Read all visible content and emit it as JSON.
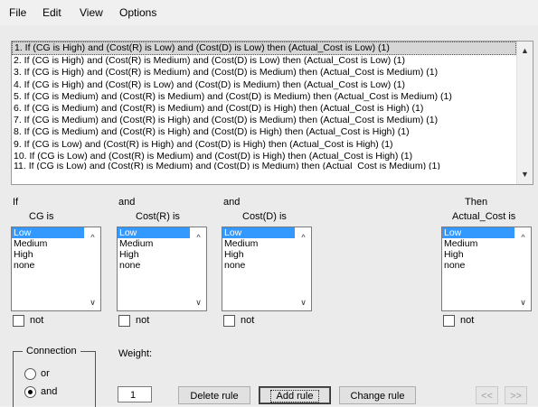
{
  "menu": [
    "File",
    "Edit",
    "View",
    "Options"
  ],
  "rules": [
    "1. If (CG is High) and (Cost(R) is Low) and (Cost(D) is Low) then (Actual_Cost is Low) (1)",
    "2. If (CG is High) and (Cost(R) is Medium) and (Cost(D) is Low) then (Actual_Cost is Low) (1)",
    "3. If (CG is High) and (Cost(R) is Medium) and (Cost(D) is Medium) then (Actual_Cost is Medium) (1)",
    "4. If (CG is High) and (Cost(R) is Low) and (Cost(D) is Medium) then (Actual_Cost is Low) (1)",
    "5. If (CG is Medium) and (Cost(R) is Medium) and (Cost(D) is Medium) then (Actual_Cost is Medium) (1)",
    "6. If (CG is Medium) and (Cost(R) is Medium) and (Cost(D) is High) then (Actual_Cost is High) (1)",
    "7. If (CG is Medium) and (Cost(R) is High) and (Cost(D) is Medium) then (Actual_Cost is Medium) (1)",
    "8. If (CG is Medium) and (Cost(R) is High) and (Cost(D) is High) then (Actual_Cost is High) (1)",
    "9. If (CG is Low) and (Cost(R) is High) and (Cost(D) is High) then (Actual_Cost is High) (1)",
    "10. If (CG is Low) and (Cost(R) is Medium) and (Cost(D) is High) then (Actual_Cost is High) (1)",
    "11. If (CG is Low) and (Cost(R) is Medium) and (Cost(D) is Medium) then (Actual_Cost is Medium) (1)"
  ],
  "selected_rule": 1,
  "columns": {
    "cg": {
      "connector": "If",
      "name": "CG is"
    },
    "costr": {
      "connector": "and",
      "name": "Cost(R) is"
    },
    "costd": {
      "connector": "and",
      "name": "Cost(D) is"
    },
    "actual": {
      "connector": "Then",
      "name": "Actual_Cost is"
    }
  },
  "options": [
    "Low",
    "Medium",
    "High",
    "none"
  ],
  "selected_option": "Low",
  "not_label": "not",
  "connection": {
    "legend": "Connection",
    "or": "or",
    "and": "and",
    "selected": "and"
  },
  "weight": {
    "label": "Weight:",
    "value": "1"
  },
  "buttons": {
    "delete": "Delete rule",
    "add": "Add rule",
    "change": "Change rule",
    "prev": "<<",
    "next": ">>"
  }
}
